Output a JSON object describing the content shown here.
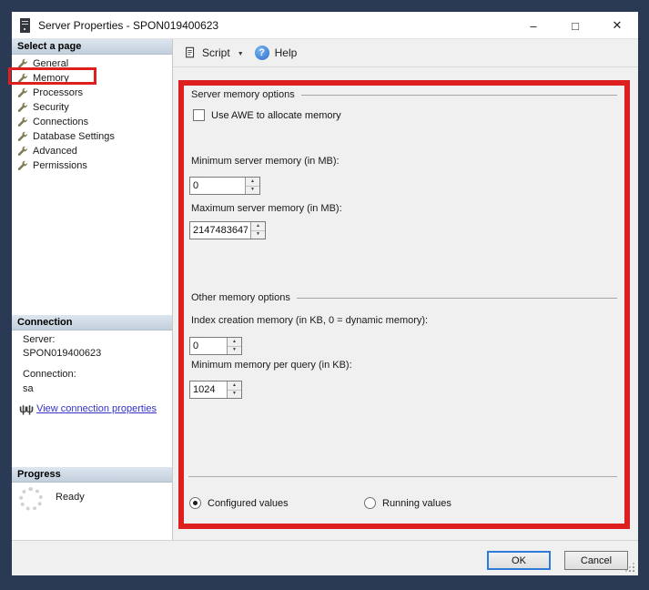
{
  "window": {
    "title": "Server Properties - SPON019400623",
    "controls": {
      "minimize": "–",
      "maximize": "□",
      "close": "✕"
    }
  },
  "toolbar": {
    "script_label": "Script",
    "dropdown_icon": "▼",
    "help_icon_glyph": "?",
    "help_label": "Help"
  },
  "sidebar": {
    "select_page_header": "Select a page",
    "pages": [
      {
        "label": "General"
      },
      {
        "label": "Memory",
        "annotated": true
      },
      {
        "label": "Processors"
      },
      {
        "label": "Security"
      },
      {
        "label": "Connections"
      },
      {
        "label": "Database Settings"
      },
      {
        "label": "Advanced"
      },
      {
        "label": "Permissions"
      }
    ],
    "connection": {
      "header": "Connection",
      "server_label": "Server:",
      "server_value": "SPON019400623",
      "connection_label": "Connection:",
      "connection_value": "sa",
      "link_icon": "ψψ",
      "link_text": "View connection properties"
    },
    "progress": {
      "header": "Progress",
      "status": "Ready"
    }
  },
  "main": {
    "server_memory_group": "Server memory options",
    "awe_checkbox_label": "Use AWE to allocate memory",
    "awe_checked": false,
    "min_server_memory_label": "Minimum server memory (in MB):",
    "min_server_memory_value": "0",
    "max_server_memory_label": "Maximum server memory (in MB):",
    "max_server_memory_value": "2147483647",
    "other_memory_group": "Other memory options",
    "index_creation_label": "Index creation memory (in KB, 0 = dynamic memory):",
    "index_creation_value": "0",
    "min_memory_query_label": "Minimum memory per query (in KB):",
    "min_memory_query_value": "1024",
    "configured_values_label": "Configured values",
    "running_values_label": "Running values",
    "selected_mode": "configured"
  },
  "footer": {
    "ok_label": "OK",
    "cancel_label": "Cancel"
  },
  "icons": {
    "spin_up": "▲",
    "spin_down": "▼"
  },
  "colors": {
    "annotation_red": "#dd1f1f",
    "background_navy": "#2b3a54",
    "help_blue": "#2a6fce",
    "link_blue": "#3333cc"
  }
}
